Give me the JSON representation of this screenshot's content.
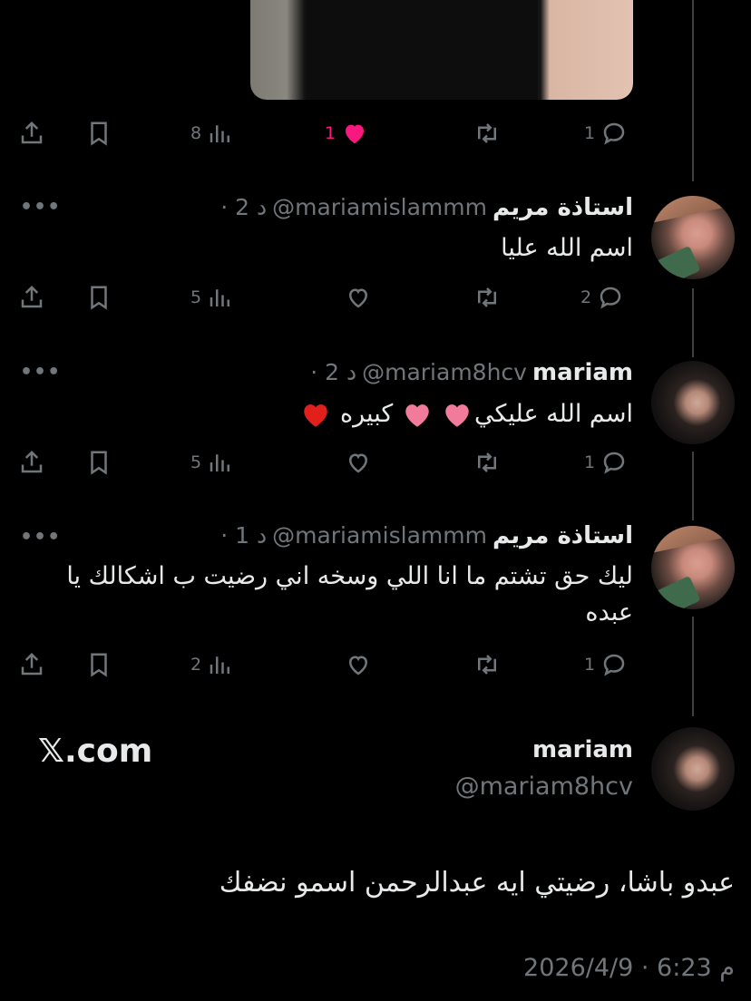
{
  "actions_top": {
    "views": "8",
    "likes": "1",
    "replies": "1"
  },
  "replies": [
    {
      "name": "استاذة مريم",
      "handle": "@mariamislammm",
      "time": "· 2 د",
      "text": "اسم الله عليا",
      "views": "5",
      "replies": "2"
    },
    {
      "name": "mariam",
      "handle": "@mariam8hcv",
      "time": "· 2 د",
      "text": "اسم الله عليكي",
      "text_end": "كبيره",
      "views": "5",
      "replies": "1"
    },
    {
      "name": "استاذة مريم",
      "handle": "@mariamislammm",
      "time": "· 1 د",
      "text": "ليك حق تشتم ما انا اللي وسخه اني رضيت ب اشكالك يا عبده",
      "views": "2",
      "replies": "1"
    }
  ],
  "main_post": {
    "name": "mariam",
    "handle": "@mariam8hcv",
    "site": "𝕏.com",
    "text": "عبدو باشا، رضيتي ايه عبدالرحمن اسمو نضفك",
    "timestamp": "2026/4/9 · 6:23 م"
  },
  "colors": {
    "background": "#000000",
    "text": "#e7e9ea",
    "secondary": "#71767b",
    "like": "#f91880",
    "thread_line": "#3e4144"
  }
}
